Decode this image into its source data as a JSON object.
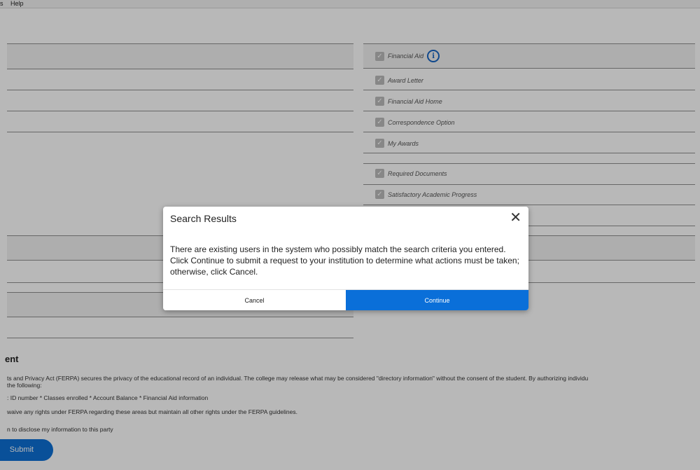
{
  "menubar": {
    "items": [
      "s",
      "Help"
    ]
  },
  "financial_aid": {
    "header": "Financial Aid",
    "items": [
      "Award Letter",
      "Financial Aid Home",
      "Correspondence Option",
      "My Awards",
      "Required Documents",
      "Satisfactory Academic Progress"
    ]
  },
  "consent": {
    "title": "ent",
    "line1": "ts and Privacy Act (FERPA) secures the privacy of the educational record of an individual. The college may release what may be considered \"directory information\" without the consent of the student. By authorizing individu",
    "line2": "the following:",
    "line3": ": ID number * Classes enrolled * Account Balance * Financial Aid information",
    "line4": "waive any rights under FERPA regarding these areas but maintain all other rights under the FERPA guidelines.",
    "line5": "n to disclose my information to this party",
    "submit_label": "Submit"
  },
  "modal": {
    "title": "Search Results",
    "close_glyph": "✕",
    "body": "There are existing users in the system who possibly match the search criteria you entered. Click Continue to submit a request to your institution to determine what actions must be taken; otherwise, click Cancel.",
    "cancel_label": "Cancel",
    "continue_label": "Continue"
  }
}
